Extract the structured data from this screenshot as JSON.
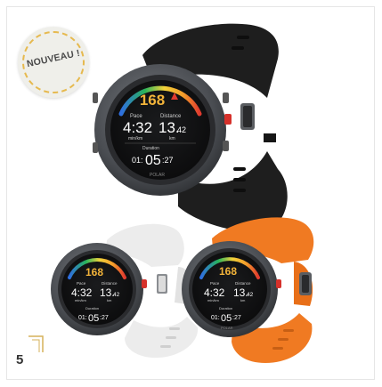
{
  "badge": {
    "label": "NOUVEAU !"
  },
  "page_number": "5",
  "watch_screen": {
    "heart_rate": "168",
    "pace_label": "Pace",
    "pace_value": "4:32",
    "pace_unit": "min/km",
    "distance_label": "Distance",
    "distance_main": "13.",
    "distance_decimals": "42",
    "distance_unit": "km",
    "duration_label": "Duration",
    "duration_hours": "01:",
    "duration_minutes": "05",
    "duration_seconds": ":27",
    "brand": "POLAR"
  },
  "colors": {
    "black_band": "#1e1e1e",
    "white_band": "#ececec",
    "orange_band": "#f07a22",
    "heart_rate_text": "#f3b43a",
    "button_red": "#d6312b",
    "badge_ring": "#e6b94e"
  }
}
